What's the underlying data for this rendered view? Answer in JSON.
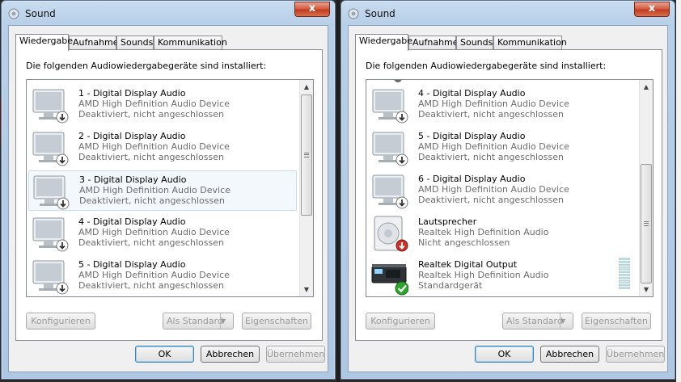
{
  "dialogs": [
    {
      "title": "Sound",
      "close_label": "x",
      "tabs": [
        "Wiedergabe",
        "Aufnahme",
        "Sounds",
        "Kommunikation"
      ],
      "caption": "Die folgenden Audiowiedergabegeräte sind installiert:",
      "devices": [
        {
          "icon": "monitor-icon",
          "name": "1 - Digital Display Audio",
          "driver": "AMD High Definition Audio Device",
          "status": "Deaktiviert, nicht angeschlossen"
        },
        {
          "icon": "monitor-icon",
          "name": "2 - Digital Display Audio",
          "driver": "AMD High Definition Audio Device",
          "status": "Deaktiviert, nicht angeschlossen"
        },
        {
          "icon": "monitor-icon",
          "name": "3 - Digital Display Audio",
          "driver": "AMD High Definition Audio Device",
          "status": "Deaktiviert, nicht angeschlossen",
          "selected": true
        },
        {
          "icon": "monitor-icon",
          "name": "4 - Digital Display Audio",
          "driver": "AMD High Definition Audio Device",
          "status": "Deaktiviert, nicht angeschlossen"
        },
        {
          "icon": "monitor-icon",
          "name": "5 - Digital Display Audio",
          "driver": "AMD High Definition Audio Device",
          "status": "Deaktiviert, nicht angeschlossen"
        }
      ],
      "buttons": {
        "configure": "Konfigurieren",
        "set_default": "Als Standard",
        "properties": "Eigenschaften",
        "ok": "OK",
        "cancel": "Abbrechen",
        "apply": "Übernehmen"
      }
    },
    {
      "title": "Sound",
      "close_label": "x",
      "tabs": [
        "Wiedergabe",
        "Aufnahme",
        "Sounds",
        "Kommunikation"
      ],
      "caption": "Die folgenden Audiowiedergabegeräte sind installiert:",
      "devices": [
        {
          "icon": "monitor-icon",
          "name": "4 - Digital Display Audio",
          "driver": "AMD High Definition Audio Device",
          "status": "Deaktiviert, nicht angeschlossen"
        },
        {
          "icon": "monitor-icon",
          "name": "5 - Digital Display Audio",
          "driver": "AMD High Definition Audio Device",
          "status": "Deaktiviert, nicht angeschlossen"
        },
        {
          "icon": "monitor-icon",
          "name": "6 - Digital Display Audio",
          "driver": "AMD High Definition Audio Device",
          "status": "Deaktiviert, nicht angeschlossen"
        },
        {
          "icon": "speaker-icon",
          "name": "Lautsprecher",
          "driver": "Realtek High Definition Audio",
          "status": "Nicht angeschlossen"
        },
        {
          "icon": "digital-output-icon",
          "name": "Realtek Digital Output",
          "driver": "Realtek High Definition Audio",
          "status": "Standardgerät",
          "default_device": true
        }
      ],
      "buttons": {
        "configure": "Konfigurieren",
        "set_default": "Als Standard",
        "properties": "Eigenschaften",
        "ok": "OK",
        "cancel": "Abbrechen",
        "apply": "Übernehmen"
      }
    }
  ],
  "colors": {
    "selection": "#c7ddf2",
    "default_check": "#2ea42c",
    "disconnected_badge": "#c8322b"
  }
}
